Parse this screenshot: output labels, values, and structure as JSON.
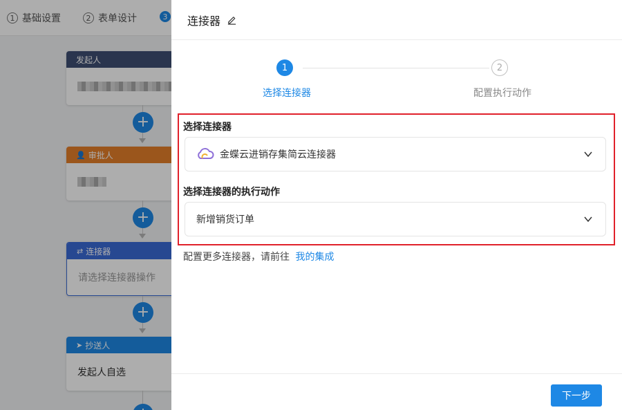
{
  "topbar": {
    "steps": [
      {
        "num": "1",
        "label": "基础设置"
      },
      {
        "num": "2",
        "label": "表单设计"
      },
      {
        "num": "3",
        "label": ""
      }
    ]
  },
  "flow": {
    "sender": {
      "title": "发起人"
    },
    "approver": {
      "title": "审批人"
    },
    "connector": {
      "title": "连接器",
      "placeholder": "请选择连接器操作"
    },
    "cc": {
      "title": "抄送人",
      "value": "发起人自选"
    }
  },
  "drawer": {
    "title": "连接器",
    "steps": [
      {
        "num": "1",
        "label": "选择连接器"
      },
      {
        "num": "2",
        "label": "配置执行动作"
      }
    ],
    "connector_label": "选择连接器",
    "connector_value": "金蝶云进销存集简云连接器",
    "action_label": "选择连接器的执行动作",
    "action_value": "新增销货订单",
    "more_text": "配置更多连接器，请前往",
    "more_link": "我的集成",
    "next_button": "下一步"
  },
  "colors": {
    "primary": "#1e88e5",
    "highlight": "#e0202a",
    "sender_head": "#3f4f73",
    "approver_head": "#e57f2a",
    "connector_head": "#3a6ad6"
  }
}
